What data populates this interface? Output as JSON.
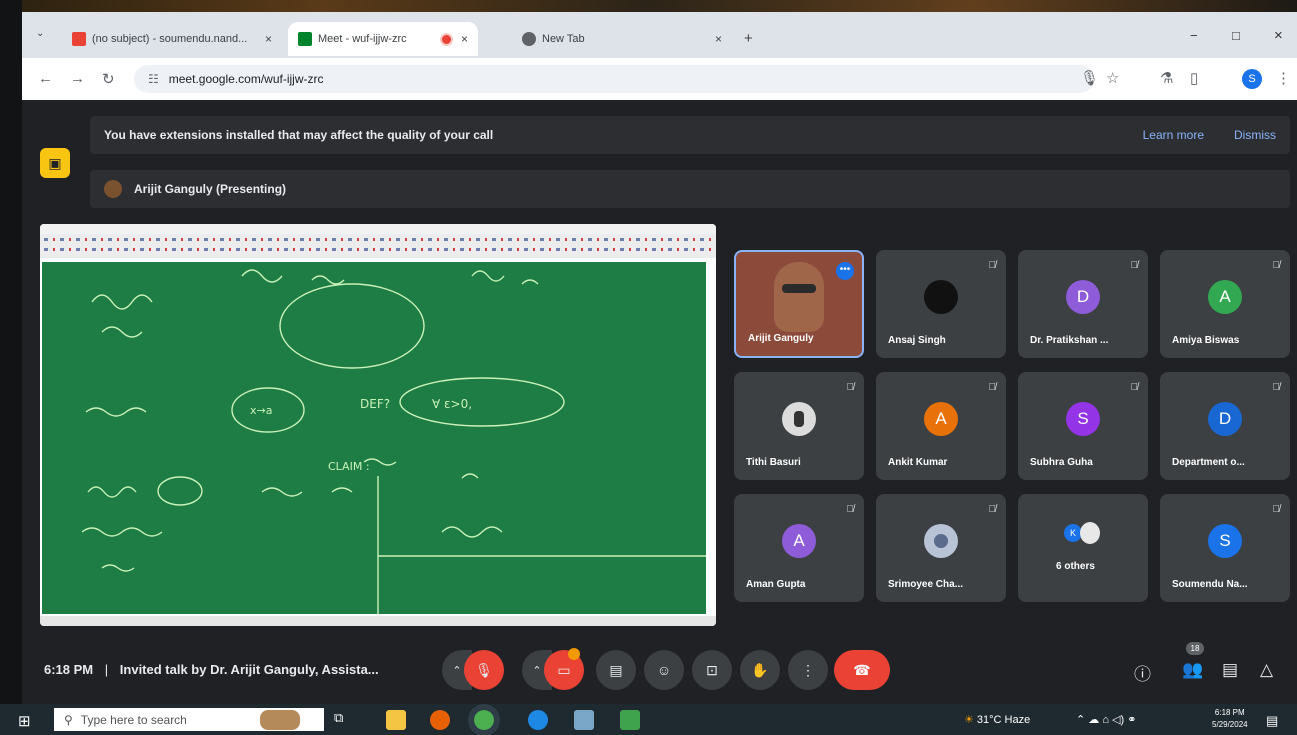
{
  "browser": {
    "tabs": [
      {
        "title": "(no subject) - soumendu.nand...",
        "close": "×"
      },
      {
        "title": "Meet - wuf-ijjw-zrc",
        "close": "×"
      },
      {
        "title": "New Tab",
        "close": "×"
      }
    ],
    "new_tab": "+",
    "url": "meet.google.com/wuf-ijjw-zrc",
    "profile_initial": "S",
    "window_controls": [
      "−",
      "□",
      "×"
    ]
  },
  "meet": {
    "extensions_banner": {
      "text": "You have extensions installed that may affect the quality of your call",
      "learn_more": "Learn more",
      "dismiss": "Dismiss"
    },
    "presenting_label": "Arijit Ganguly (Presenting)",
    "participants": [
      {
        "name": "Arijit Ganguly",
        "type": "video"
      },
      {
        "name": "Ansaj Singh",
        "type": "dark-avatar"
      },
      {
        "name": "Dr. Pratikshan ...",
        "initial": "D",
        "color": "#8e5cd9"
      },
      {
        "name": "Amiya Biswas",
        "initial": "A",
        "color": "#33a852"
      },
      {
        "name": "Tithi Basuri",
        "type": "photo"
      },
      {
        "name": "Ankit Kumar",
        "initial": "A",
        "color": "#e8710a"
      },
      {
        "name": "Subhra Guha",
        "initial": "S",
        "color": "#9334e6"
      },
      {
        "name": "Department o...",
        "initial": "D",
        "color": "#1967d2"
      },
      {
        "name": "Aman Gupta",
        "initial": "A",
        "color": "#8e5cd9"
      },
      {
        "name": "Srimoyee Cha...",
        "type": "photo"
      },
      {
        "name": "6 others",
        "type": "group"
      },
      {
        "name": "Soumendu Na...",
        "initial": "S",
        "color": "#1a73e8"
      }
    ],
    "meeting_time": "6:18 PM",
    "meeting_title": "Invited talk by Dr. Arijit Ganguly, Assista...",
    "people_count": "18",
    "board_text": [
      "CLAIM :",
      "DEF?",
      "∀ ε>0,",
      "x→a"
    ]
  },
  "taskbar": {
    "search_placeholder": "Type here to search",
    "weather": "31°C Haze",
    "time": "6:18 PM",
    "date": "5/29/2024"
  }
}
